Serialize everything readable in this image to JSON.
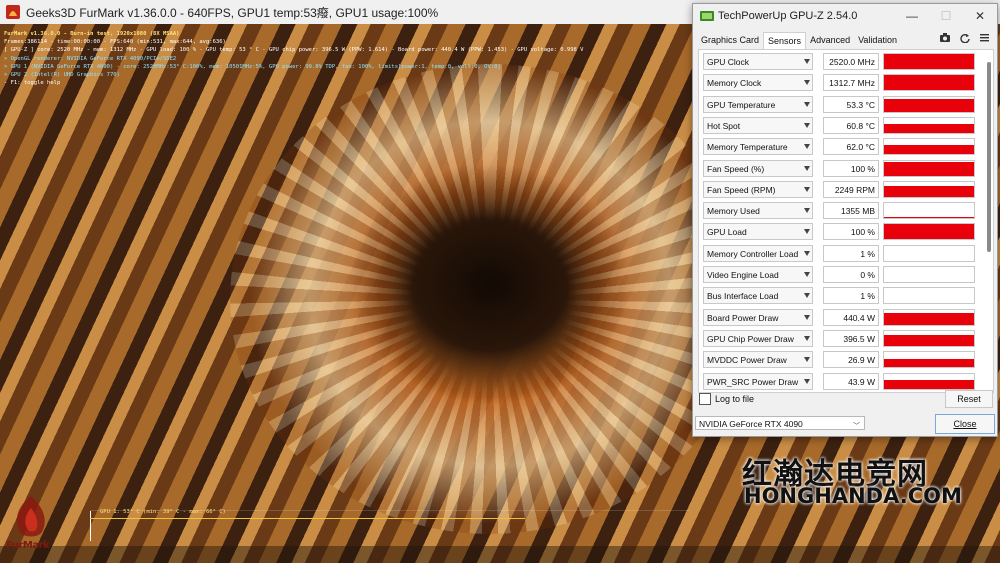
{
  "furmark": {
    "window_title": "Geeks3D FurMark v1.36.0.0 - 640FPS, GPU1 temp:53癈, GPU1 usage:100%",
    "overlay_lines": [
      "FurMark v1.36.0.0 - Burn-in test, 1920x1080 (8X MSAA)",
      "Frames:386114 - time:00:00:00 - FPS:640 (min:531, max:644, avg:636)",
      "[ GPU-Z ] core: 2520 MHz - mem: 1312 MHz - GPU load: 100 % - GPU temp: 53 ° C - GPU chip power: 396.5 W (PPW: 1.614) - Board power: 440.4 W (PPW: 1.453) - GPU voltage: 0.998 V",
      "> OpenGL renderer: NVIDIA GeForce RTX 4090/PCIe/SSE2",
      "> GPU 1 (NVIDIA GeForce RTX 4090) - core: 2520MHz:53° C:100%, mem: 10501MHz:5%, GPU power: 99.8% TDP, fan: 100%, limits[power:1, temp:0, volt:0, OV:0]",
      "> GPU 2 (Intel(R) UHD Graphics 770)",
      "- F1: toggle help"
    ],
    "temp_graph_label": "GPU 1: 53° C (min: 39° C - max: 66° C)",
    "logo_text": "FurMark"
  },
  "gpuz": {
    "title": "TechPowerUp GPU-Z 2.54.0",
    "window_buttons": [
      "—",
      "☐",
      "✕"
    ],
    "tabs": [
      "Graphics Card",
      "Sensors",
      "Advanced",
      "Validation"
    ],
    "active_tab": "Sensors",
    "tab_icons": [
      "camera-icon",
      "refresh-icon",
      "menu-icon"
    ],
    "sensors": [
      {
        "name": "GPU Clock",
        "value": "2520.0 MHz",
        "level": 1.0
      },
      {
        "name": "Memory Clock",
        "value": "1312.7 MHz",
        "level": 1.0
      },
      {
        "name": "GPU Temperature",
        "value": "53.3 °C",
        "level": 0.85
      },
      {
        "name": "Hot Spot",
        "value": "60.8 °C",
        "level": 0.62
      },
      {
        "name": "Memory Temperature",
        "value": "62.0 °C",
        "level": 0.6
      },
      {
        "name": "Fan Speed (%)",
        "value": "100 %",
        "level": 0.9
      },
      {
        "name": "Fan Speed (RPM)",
        "value": "2249 RPM",
        "level": 0.75
      },
      {
        "name": "Memory Used",
        "value": "1355 MB",
        "level": 0.08
      },
      {
        "name": "GPU Load",
        "value": "100 %",
        "level": 1.0
      },
      {
        "name": "Memory Controller Load",
        "value": "1 %",
        "level": 0.0
      },
      {
        "name": "Video Engine Load",
        "value": "0 %",
        "level": 0.0
      },
      {
        "name": "Bus Interface Load",
        "value": "1 %",
        "level": 0.0
      },
      {
        "name": "Board Power Draw",
        "value": "440.4 W",
        "level": 0.8
      },
      {
        "name": "GPU Chip Power Draw",
        "value": "396.5 W",
        "level": 0.75
      },
      {
        "name": "MVDDC Power Draw",
        "value": "26.9 W",
        "level": 0.55
      },
      {
        "name": "PWR_SRC Power Draw",
        "value": "43.9 W",
        "level": 0.55
      }
    ],
    "log_to_file": "Log to file",
    "reset": "Reset",
    "gpu_select": "NVIDIA GeForce RTX 4090",
    "close": "Close"
  },
  "watermark": {
    "cn": "红瀚达电竞网",
    "en": "HONGHANDA.COM"
  }
}
